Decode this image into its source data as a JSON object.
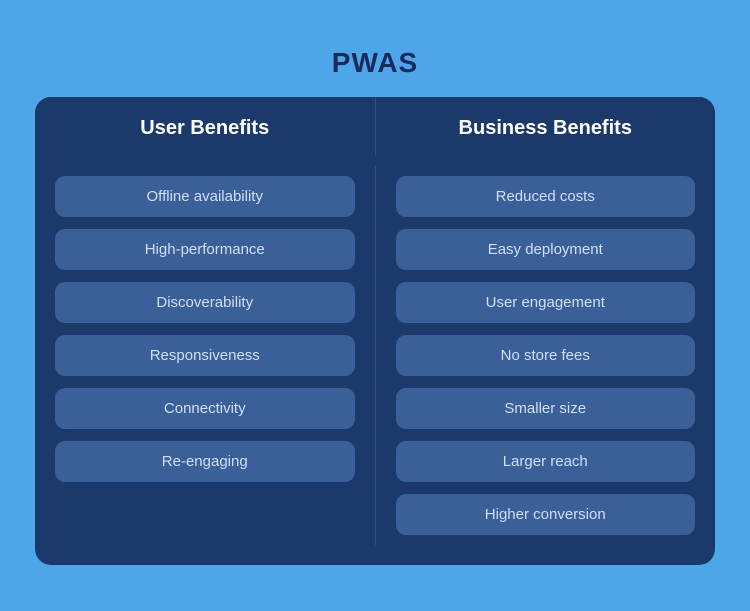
{
  "title": "PWAS",
  "columns": {
    "user_header": "User Benefits",
    "business_header": "Business Benefits",
    "user_items": [
      "Offline availability",
      "High-performance",
      "Discoverability",
      "Responsiveness",
      "Connectivity",
      "Re-engaging"
    ],
    "business_items": [
      "Reduced costs",
      "Easy deployment",
      "User engagement",
      "No store fees",
      "Smaller size",
      "Larger reach",
      "Higher conversion"
    ]
  }
}
